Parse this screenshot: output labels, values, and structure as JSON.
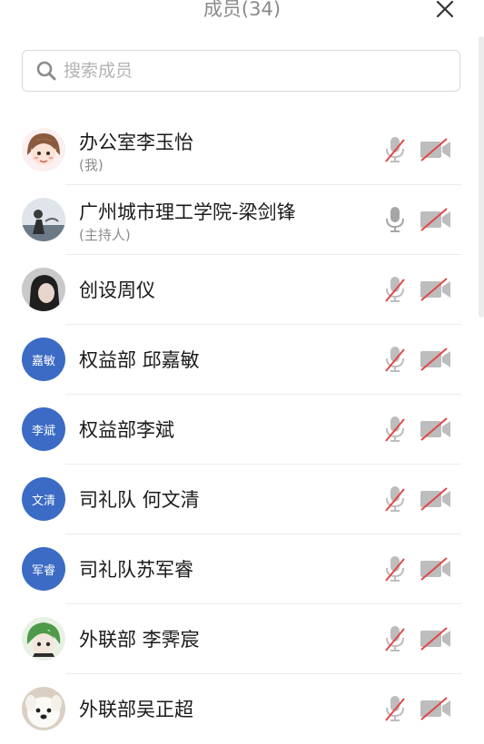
{
  "header": {
    "title": "成员(34)"
  },
  "search": {
    "placeholder": "搜索成员"
  },
  "members": [
    {
      "name": "办公室李玉怡",
      "sub": "(我)",
      "avatar": "illustrated-character",
      "mic_muted": true,
      "camera_off": true
    },
    {
      "name": "广州城市理工学院-梁剑锋",
      "sub": "(主持人)",
      "avatar": "photo",
      "mic_muted": false,
      "camera_off": true
    },
    {
      "name": "创设周仪",
      "avatar": "photo",
      "mic_muted": true,
      "camera_off": true
    },
    {
      "name": "权益部 邱嘉敏",
      "avatar_text": "嘉敏",
      "mic_muted": true,
      "camera_off": true
    },
    {
      "name": "权益部李斌",
      "avatar_text": "李斌",
      "mic_muted": true,
      "camera_off": true
    },
    {
      "name": "司礼队 何文清",
      "avatar_text": "文清",
      "mic_muted": true,
      "camera_off": true
    },
    {
      "name": "司礼队苏军睿",
      "avatar_text": "军睿",
      "mic_muted": true,
      "camera_off": true
    },
    {
      "name": "外联部 李霁宸",
      "avatar": "illustrated-character",
      "mic_muted": true,
      "camera_off": true
    },
    {
      "name": "外联部吴正超",
      "avatar": "dog-photo",
      "mic_muted": true,
      "camera_off": true
    }
  ],
  "colors": {
    "avatar_blue": "#3b6bc4",
    "muted_red": "#e04848",
    "icon_gray": "#bdbdbd"
  }
}
